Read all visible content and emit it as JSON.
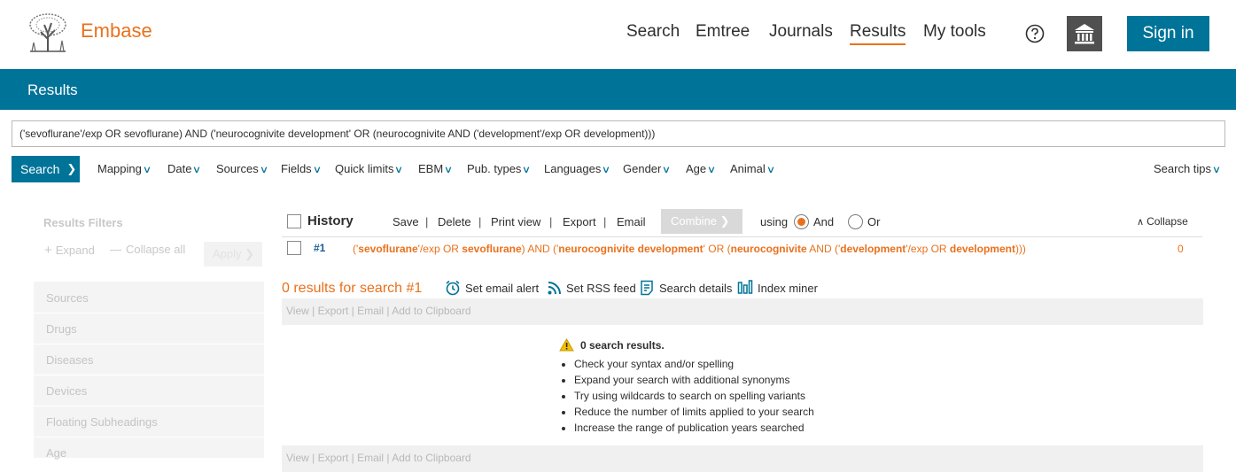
{
  "header": {
    "brand": "Embase",
    "nav": [
      "Search",
      "Emtree",
      "Journals",
      "Results",
      "My tools"
    ],
    "active_nav": "Results",
    "sign_in": "Sign in",
    "accent": "#e9711c",
    "primary": "#007398"
  },
  "page": {
    "title": "Results"
  },
  "query": {
    "value": "('sevoflurane'/exp OR sevoflurane) AND ('neurocognivite development' OR (neurocognivite AND ('development'/exp OR development)))",
    "search_label": "Search",
    "options": [
      "Mapping",
      "Date",
      "Sources",
      "Fields",
      "Quick limits",
      "EBM",
      "Pub. types",
      "Languages",
      "Gender",
      "Age",
      "Animal"
    ],
    "search_tips": "Search tips"
  },
  "sidebar": {
    "title": "Results Filters",
    "expand": "Expand",
    "collapse_all": "Collapse all",
    "apply": "Apply",
    "filters": [
      "Sources",
      "Drugs",
      "Diseases",
      "Devices",
      "Floating Subheadings",
      "Age"
    ]
  },
  "history": {
    "title": "History",
    "actions": [
      "Save",
      "Delete",
      "Print view",
      "Export",
      "Email"
    ],
    "combine": "Combine",
    "using": "using",
    "and_label": "And",
    "or_label": "Or",
    "collapse": "Collapse",
    "rows": [
      {
        "num": "#1",
        "parts": [
          {
            "t": "('",
            "b": false
          },
          {
            "t": "sevoflurane",
            "b": true
          },
          {
            "t": "'/exp OR ",
            "b": false
          },
          {
            "t": "sevoflurane",
            "b": true
          },
          {
            "t": ") AND ('",
            "b": false
          },
          {
            "t": "neurocognivite development",
            "b": true
          },
          {
            "t": "' OR (",
            "b": false
          },
          {
            "t": "neurocognivite",
            "b": true
          },
          {
            "t": " AND ('",
            "b": false
          },
          {
            "t": "development",
            "b": true
          },
          {
            "t": "'/exp OR ",
            "b": false
          },
          {
            "t": "development",
            "b": true
          },
          {
            "t": ")))",
            "b": false
          }
        ],
        "count": "0"
      }
    ]
  },
  "results": {
    "count_text": "0 results for search #1",
    "tools": [
      "Set email alert",
      "Set RSS feed",
      "Search details",
      "Index miner"
    ],
    "bar_actions": [
      "View",
      "Export",
      "Email",
      "Add to Clipboard"
    ],
    "empty_title": "0 search results.",
    "tips": [
      "Check your syntax and/or spelling",
      "Expand your search with additional synonyms",
      "Try using wildcards to search on spelling variants",
      "Reduce the number of limits applied to your search",
      "Increase the range of publication years searched"
    ]
  },
  "icons": [
    "tree-logo-icon",
    "help-icon",
    "institution-icon",
    "chevron-right-icon",
    "chevron-down-icon",
    "alarm-clock-icon",
    "rss-icon",
    "document-icon",
    "bar-chart-icon",
    "warning-icon",
    "plus-icon",
    "minus-icon"
  ]
}
